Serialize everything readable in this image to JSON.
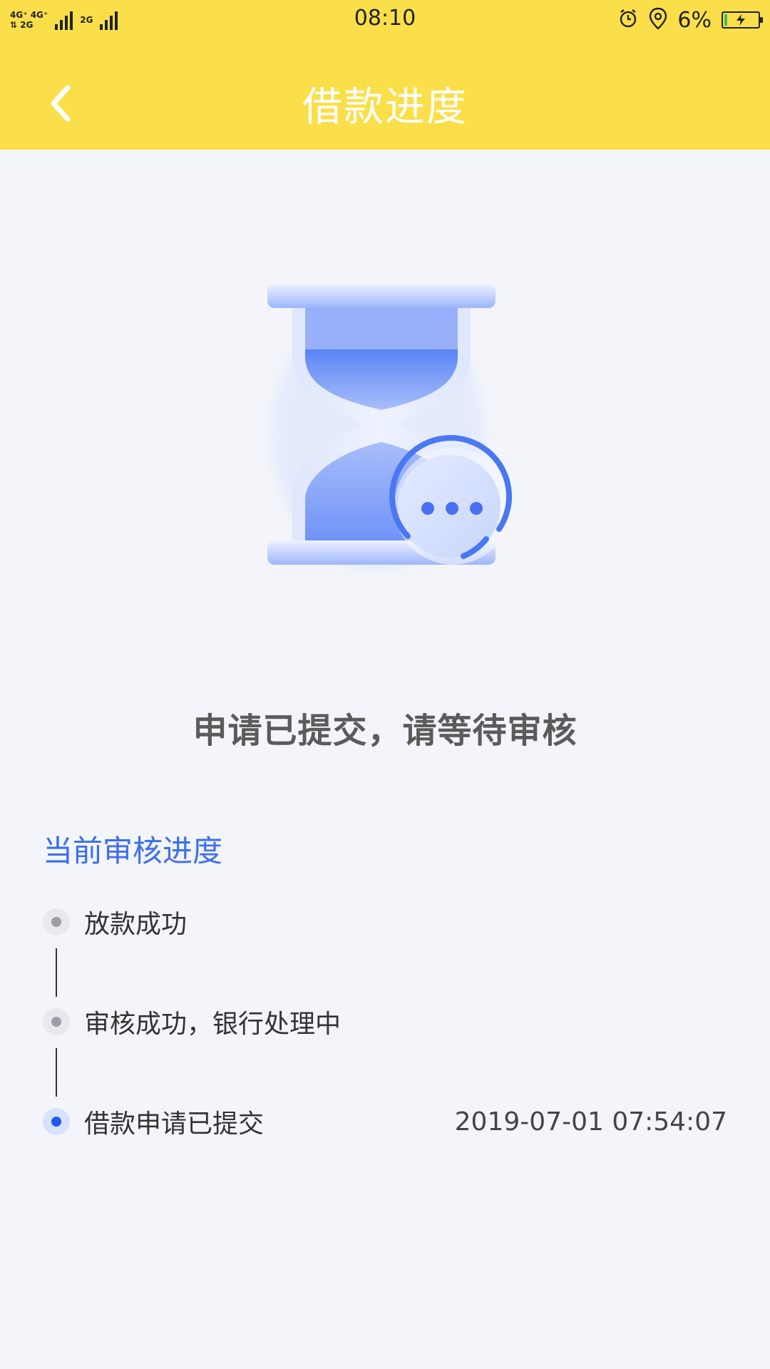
{
  "status_bar": {
    "net_top": "4G⁺ 4G⁺",
    "net_bottom": "⇅ 2G",
    "net_extra": "2G",
    "time": "08:10",
    "battery_percent": "6%",
    "icons": [
      "alarm-icon",
      "location-icon",
      "battery-charging-icon"
    ]
  },
  "header": {
    "title": "借款进度",
    "back_icon": "chevron-left-icon"
  },
  "illustration": {
    "icon": "hourglass-waiting-icon"
  },
  "message": "申请已提交，请等待审核",
  "progress": {
    "section_title": "当前审核进度",
    "steps": [
      {
        "label": "放款成功",
        "time": "",
        "state": "pending"
      },
      {
        "label": "审核成功，银行处理中",
        "time": "",
        "state": "pending"
      },
      {
        "label": "借款申请已提交",
        "time": "2019-07-01 07:54:07",
        "state": "active"
      }
    ]
  },
  "colors": {
    "header_bg": "#fbdf4a",
    "accent_blue": "#3d6ef0",
    "page_bg": "#f3f5fa"
  }
}
